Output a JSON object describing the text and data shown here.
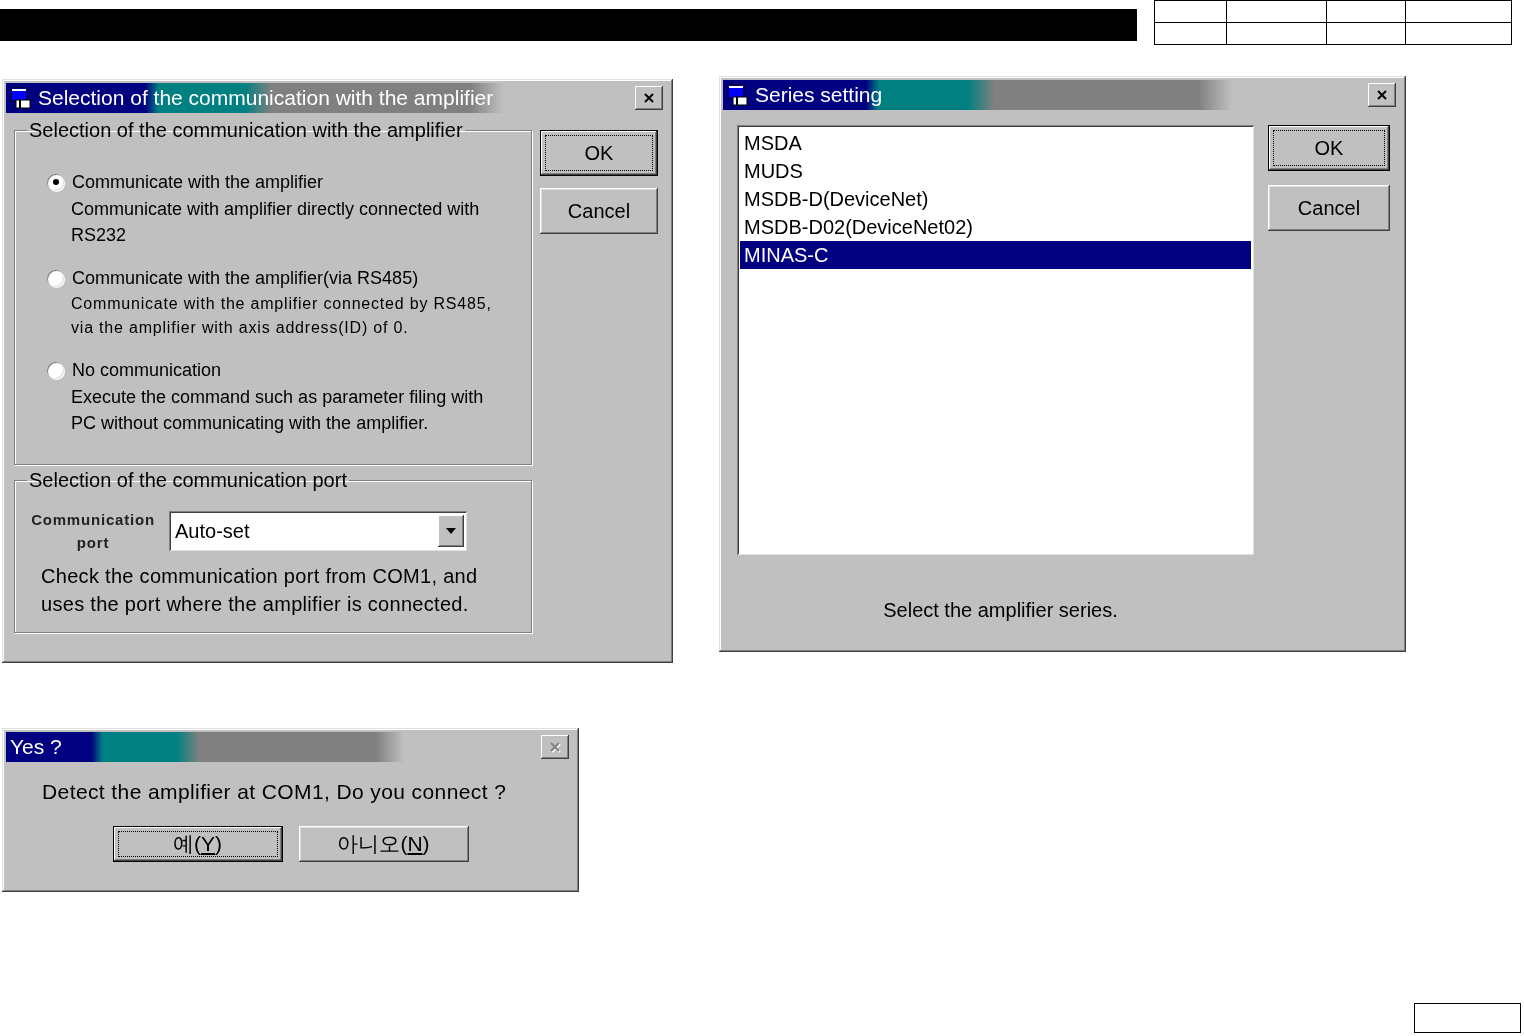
{
  "communication_dialog": {
    "title": "Selection of the communication with the amplifier",
    "close_disabled": false,
    "mode_group": {
      "legend": "Selection of the communication with the amplifier",
      "options": [
        {
          "label": "Communicate with the amplifier",
          "description": "Communicate with amplifier directly connected with RS232",
          "selected": true,
          "kind": "plain"
        },
        {
          "label": "Communicate with the amplifier(via RS485)",
          "description": "Communicate with the amplifier connected by RS485, via the amplifier with axis address(ID) of 0.",
          "selected": false,
          "kind": "spaced"
        },
        {
          "label": "No communication",
          "description": "Execute the command such as parameter filing with PC without communicating with the amplifier.",
          "selected": false,
          "kind": "plain"
        }
      ]
    },
    "port_group": {
      "legend": "Selection of the communication port",
      "field_label": "Communication port",
      "value": "Auto-set",
      "note": "Check the communication port from COM1, and uses the port where the amplifier is connected."
    },
    "buttons": [
      {
        "label": "OK",
        "default": true
      },
      {
        "label": "Cancel",
        "default": false
      }
    ]
  },
  "series_dialog": {
    "title": "Series setting",
    "close_disabled": false,
    "items": [
      {
        "label": "MSDA",
        "selected": false
      },
      {
        "label": "MUDS",
        "selected": false
      },
      {
        "label": "MSDB-D(DeviceNet)",
        "selected": false
      },
      {
        "label": "MSDB-D02(DeviceNet02)",
        "selected": false
      },
      {
        "label": "MINAS-C",
        "selected": true
      }
    ],
    "buttons": [
      {
        "label": "OK",
        "default": true
      },
      {
        "label": "Cancel",
        "default": false
      }
    ],
    "note": "Select the amplifier series."
  },
  "confirm_dialog": {
    "title": "Yes ?",
    "close_disabled": true,
    "message": "Detect the amplifier at COM1, Do you connect ?",
    "buttons": [
      {
        "prefix": "예(",
        "hotkey": "Y",
        "suffix": ")",
        "default": true
      },
      {
        "prefix": "아니오(",
        "hotkey": "N",
        "suffix": ")",
        "default": false
      }
    ]
  }
}
